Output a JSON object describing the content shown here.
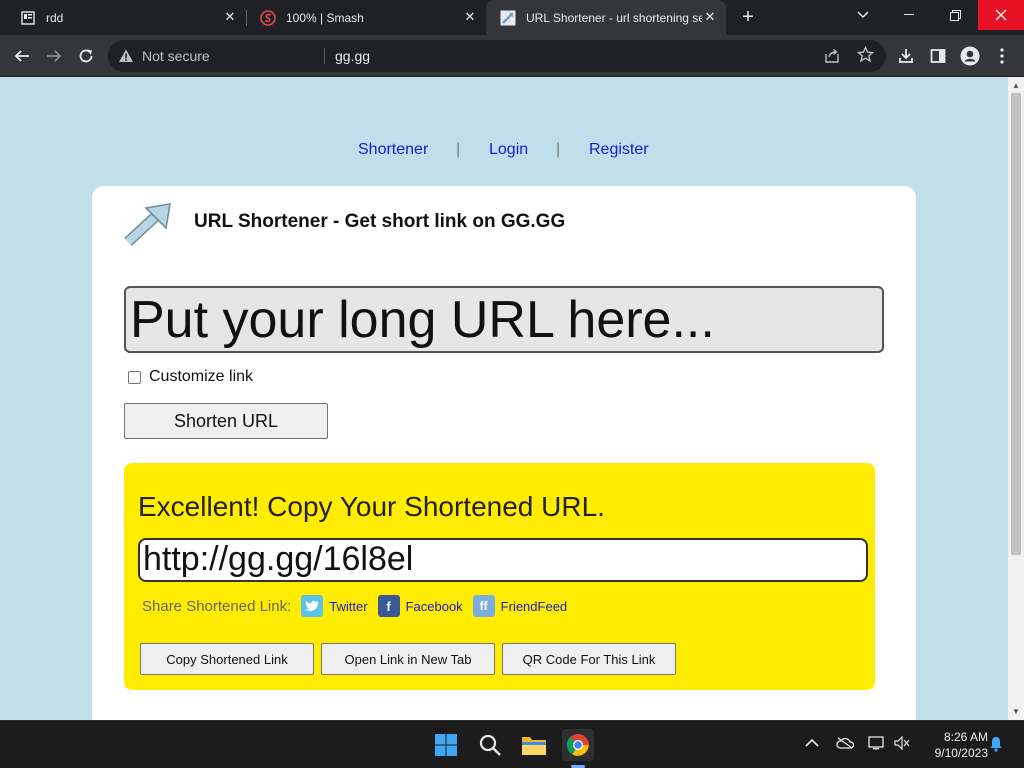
{
  "browser": {
    "tabs": [
      {
        "title": "rdd",
        "active": false
      },
      {
        "title": "100% | Smash",
        "active": false
      },
      {
        "title": "URL Shortener - url shortening se",
        "active": true
      }
    ],
    "new_tab": "+",
    "security_label": "Not secure",
    "url": "gg.gg"
  },
  "page": {
    "nav": {
      "shortener": "Shortener",
      "login": "Login",
      "register": "Register",
      "sep": "|"
    },
    "title": "URL Shortener - Get short link on GG.GG",
    "long_url_placeholder": "Put your long URL here...",
    "customize_label": "Customize link",
    "shorten_button": "Shorten URL",
    "result": {
      "heading": "Excellent! Copy Your Shortened URL.",
      "short_url": "http://gg.gg/16l8el",
      "share_label": "Share Shortened Link:",
      "share": [
        {
          "label": "Twitter"
        },
        {
          "label": "Facebook"
        },
        {
          "label": "FriendFeed"
        }
      ],
      "buttons": {
        "copy": "Copy Shortened Link",
        "open": "Open Link in New Tab",
        "qr": "QR Code For This Link"
      }
    }
  },
  "taskbar": {
    "time": "8:26 AM",
    "date": "9/10/2023"
  },
  "colors": {
    "page_bg": "#bfe0ea",
    "result_bg": "#ffec00",
    "link": "#1a1ad6",
    "close_red": "#e81123"
  }
}
